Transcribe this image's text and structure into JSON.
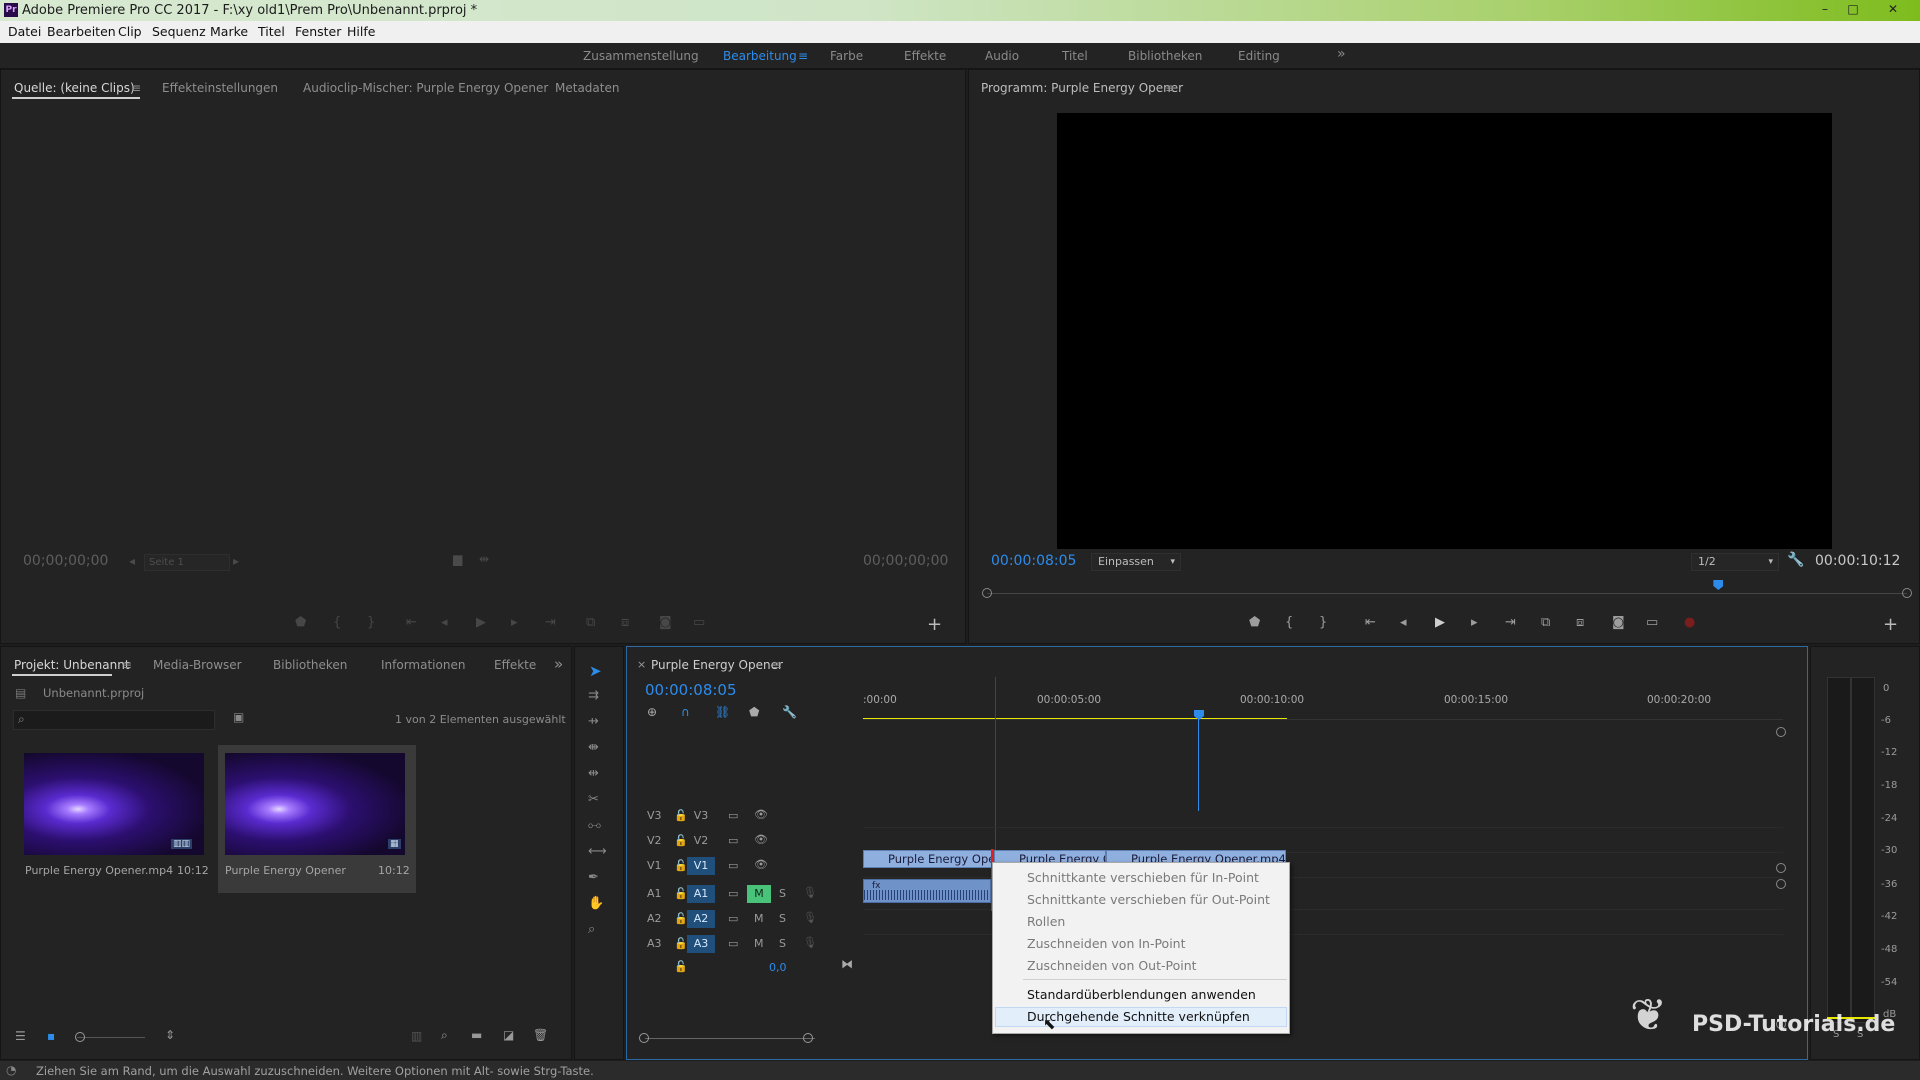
{
  "window": {
    "title": "Adobe Premiere Pro CC 2017 - F:\\xy old1\\Prem Pro\\Unbenannt.prproj *",
    "app_icon": "Pr",
    "buttons": [
      "–",
      "□",
      "✕"
    ]
  },
  "menubar": [
    "Datei",
    "Bearbeiten",
    "Clip",
    "Sequenz",
    "Marke",
    "Titel",
    "Fenster",
    "Hilfe"
  ],
  "workspaces": {
    "items": [
      "Zusammenstellung",
      "Bearbeitung",
      "Farbe",
      "Effekte",
      "Audio",
      "Titel",
      "Bibliotheken",
      "Editing"
    ],
    "active": "Bearbeitung",
    "more": "»"
  },
  "source_panel": {
    "tabs": [
      "Quelle: (keine Clips)",
      "Effekteinstellungen",
      "Audioclip-Mischer: Purple Energy Opener",
      "Metadaten"
    ],
    "timecode_left": "00;00;00;00",
    "timecode_right": "00;00;00;00",
    "page_select": "Seite 1",
    "add": "+"
  },
  "program_panel": {
    "title": "Programm: Purple Energy Opener",
    "timecode_current": "00:00:08:05",
    "fit": "Einpassen",
    "resolution": "1/2",
    "timecode_duration": "00:00:10:12",
    "playhead_fraction": 0.795,
    "add": "+"
  },
  "project_panel": {
    "tabs": [
      "Projekt: Unbenannt",
      "Media-Browser",
      "Bibliotheken",
      "Informationen",
      "Effekte"
    ],
    "more": "»",
    "file": "Unbenannt.prproj",
    "selection_info": "1 von 2 Elementen ausgewählt",
    "items": [
      {
        "name": "Purple Energy Opener.mp4",
        "duration": "10:12"
      },
      {
        "name": "Purple Energy Opener",
        "duration": "10:12"
      }
    ]
  },
  "timeline": {
    "close": "×",
    "sequence_name": "Purple Energy Opener",
    "timecode": "00:00:08:05",
    "ruler": [
      ":00:00",
      "00:00:05:00",
      "00:00:10:00",
      "00:00:15:00",
      "00:00:20:00"
    ],
    "video_tracks": [
      "V3",
      "V2",
      "V1"
    ],
    "audio_tracks": [
      "A1",
      "A2",
      "A3"
    ],
    "mute": "M",
    "solo": "S",
    "master_value": "0,0",
    "clips_v1": [
      "Purple Energy Opener.mp4 [V]",
      "Purple Energy Opener.mp4 [V]",
      "Purple Energy Opener.mp4 [V]"
    ]
  },
  "context_menu": {
    "items": [
      {
        "label": "Schnittkante verschieben für In-Point",
        "enabled": false
      },
      {
        "label": "Schnittkante verschieben für Out-Point",
        "enabled": false
      },
      {
        "label": "Rollen",
        "enabled": false
      },
      {
        "label": "Zuschneiden von In-Point",
        "enabled": false
      },
      {
        "label": "Zuschneiden von Out-Point",
        "enabled": false
      },
      {
        "label": "Standardüberblendungen anwenden",
        "enabled": true
      },
      {
        "label": "Durchgehende Schnitte verknüpfen",
        "enabled": true
      }
    ]
  },
  "audio_meter": {
    "scale": [
      "0",
      "-6",
      "-12",
      "-18",
      "-24",
      "-30",
      "-36",
      "-42",
      "-48",
      "-54",
      "dB"
    ],
    "solo_labels": [
      "S",
      "S"
    ]
  },
  "watermark": "PSD-Tutorials.de",
  "status_text": "Ziehen Sie am Rand, um die Auswahl zuzuschneiden. Weitere Optionen mit Alt- sowie Strg-Taste.",
  "colors": {
    "accent_blue": "#2d8ceb",
    "clip_video": "#8fb0df",
    "clip_audio": "#6f93c9",
    "work_area": "#e6e600",
    "mute_on": "#49c27a"
  }
}
